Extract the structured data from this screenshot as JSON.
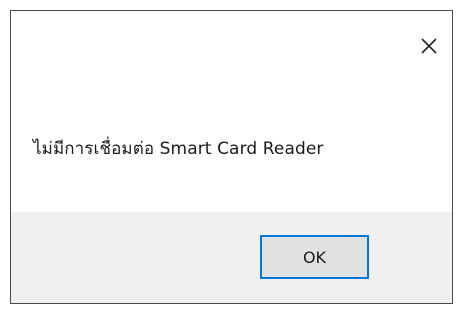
{
  "dialog": {
    "message": "ไม่มีการเชื่อมต่อ Smart Card Reader",
    "close_icon": "close-icon",
    "ok_label": "OK"
  },
  "colors": {
    "border": "#4a4a4a",
    "footer_bg": "#f0f0f0",
    "button_bg": "#e1e1e1",
    "button_focus_border": "#0078d7"
  }
}
